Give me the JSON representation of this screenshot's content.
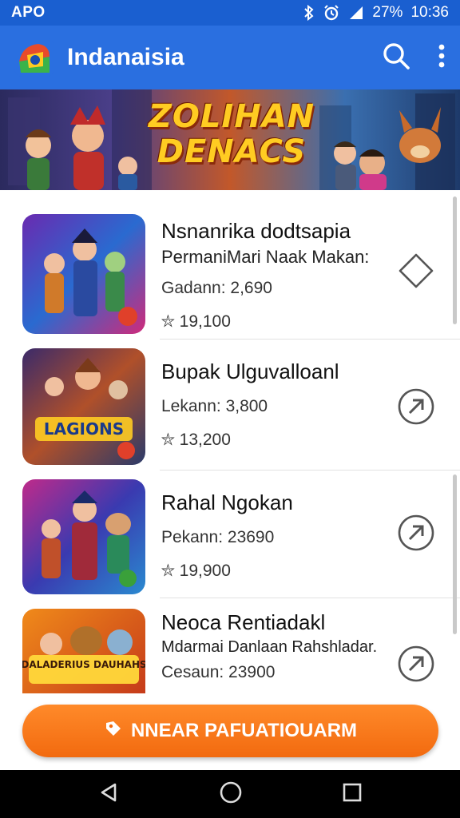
{
  "status_bar": {
    "carrier": "APO",
    "battery": "27%",
    "time": "10:36"
  },
  "app_bar": {
    "title": "Indanaisia"
  },
  "banner": {
    "title_line1": "ZOLIHAN",
    "title_line2": "DENACS"
  },
  "games": [
    {
      "name": "Nsnanrika dodtsapia",
      "subtitle": "PermaniMari Naak Makan:",
      "meta": "Gadann: 2,690",
      "price": "19,100",
      "action_icon": "diamond-outline-icon"
    },
    {
      "name": "Bupak Ulguvalloanl",
      "subtitle": "",
      "meta": "Lekann: 3,800",
      "price": "13,200",
      "action_icon": "arrow-up-right-icon"
    },
    {
      "name": "Rahal Ngokan",
      "subtitle": "",
      "meta": "Pekann: 23690",
      "price": "19,900",
      "action_icon": "arrow-up-right-icon"
    },
    {
      "name": "Neoca Rentiadakl",
      "subtitle": "Mdarmai Danlaan Rahshladar.",
      "meta": "Cesaun: 23900",
      "price": "",
      "action_icon": "arrow-up-right-icon"
    }
  ],
  "thumbnail_labels": [
    "",
    "LAGIONS",
    "",
    "DALADERIUS DAUHAHS"
  ],
  "cta": {
    "label": "NNEAR PAFUATIOUARM"
  },
  "colors": {
    "app_bar": "#2a6fe0",
    "status_bar": "#1a5fd0",
    "cta": "#f26a0f"
  }
}
